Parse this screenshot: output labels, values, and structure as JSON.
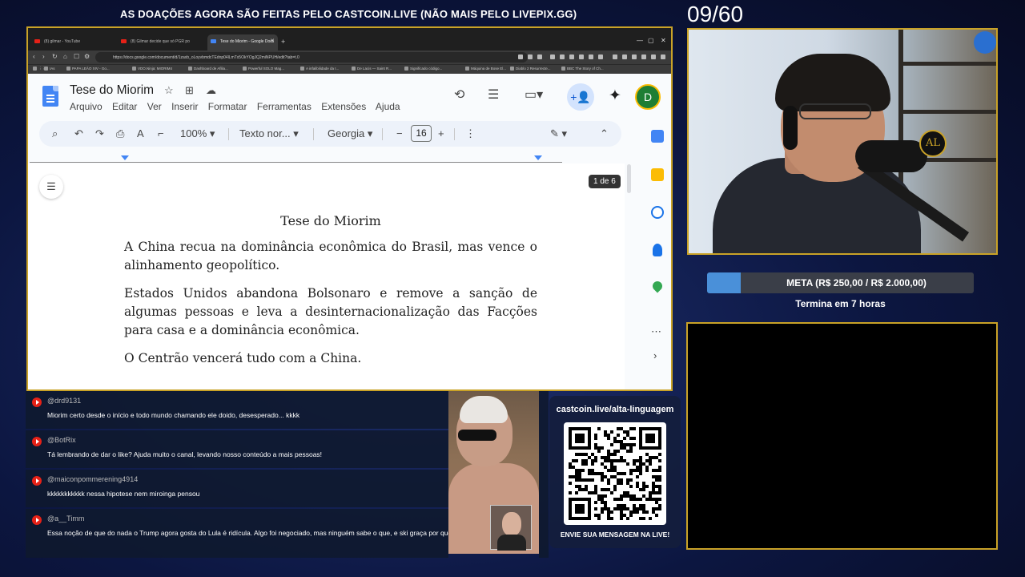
{
  "banner": "AS DOAÇÕES AGORA SÃO FEITAS PELO CASTCOIN.LIVE (NÃO MAIS PELO LIVEPIX.GG)",
  "counter": "09/60",
  "browser": {
    "tabs": [
      {
        "label": "(8) gilmar - YouTube"
      },
      {
        "label": "(8) Gilmar decide que só PGR po"
      },
      {
        "label": "Tese do Miorim - Google Docs"
      }
    ],
    "url": "https://docs.google.com/document/d/1zaxb_oLoyvbmdcTEdnp04lLmTx5OkYOgJQ2miNPUH/edit?tab=t.0",
    "bookmarks": [
      "IAs",
      "PAPA LEÃO XIV - Go...",
      "VDO.Ninja: MIORIM4",
      "Dashboard de Afilia...",
      "Powerful SOLO Mag...",
      "A infalibilidade da I...",
      "De Lacis — Saint R...",
      "Significado código...",
      "Máquina de Bose El...",
      "Diablo 2 Resurrecte...",
      "BBC The Story of Ch..."
    ]
  },
  "docs": {
    "title": "Tese do Miorim",
    "menu": [
      "Arquivo",
      "Editar",
      "Ver",
      "Inserir",
      "Formatar",
      "Ferramentas",
      "Extensões",
      "Ajuda"
    ],
    "avatar_letter": "D",
    "toolbar": {
      "zoom": "100%",
      "style": "Texto nor...",
      "font": "Georgia",
      "font_size": "16"
    },
    "page_badge": "1 de 6",
    "body": {
      "heading": "Tese do Miorim",
      "paragraphs": [
        "A China recua na dominância econômica do Brasil, mas vence o alinhamento geopolítico.",
        "Estados Unidos abandona Bolsonaro e remove a sanção de algumas pessoas e leva a desinternacionalização das Facções para casa e a dominância econômica.",
        "O Centrão vencerá tudo com a China."
      ]
    }
  },
  "goal": {
    "label": "META (R$ 250,00 / R$ 2.000,00)",
    "progress": 0.125,
    "subtitle": "Termina em 7 horas"
  },
  "chat": [
    {
      "user": "@drd9131",
      "text": "Miorim certo desde o início e todo mundo chamando ele doido, desesperado... kkkk"
    },
    {
      "user": "@BotRix",
      "text": "Tá lembrando de dar o like? Ajuda muito o canal, levando nosso conteúdo a mais pessoas!"
    },
    {
      "user": "@maiconpommerening4914",
      "text": "kkkkkkkkkkk nessa hipotese nem miroinga pensou"
    },
    {
      "user": "@a__Timm",
      "text": "Essa noção de que do nada o Trump agora gosta do Lula é ridícula. Algo foi negociado, mas ninguém sabe o que, e ski graça por que exatamente?"
    }
  ],
  "qr": {
    "title": "castcoin.live/alta-linguagem",
    "subtitle": "ENVIE SUA MENSAGEM NA LIVE!"
  },
  "colors": {
    "frame": "#c9a227",
    "goal_fill": "#4a90d9",
    "youtube_red": "#e62117"
  }
}
